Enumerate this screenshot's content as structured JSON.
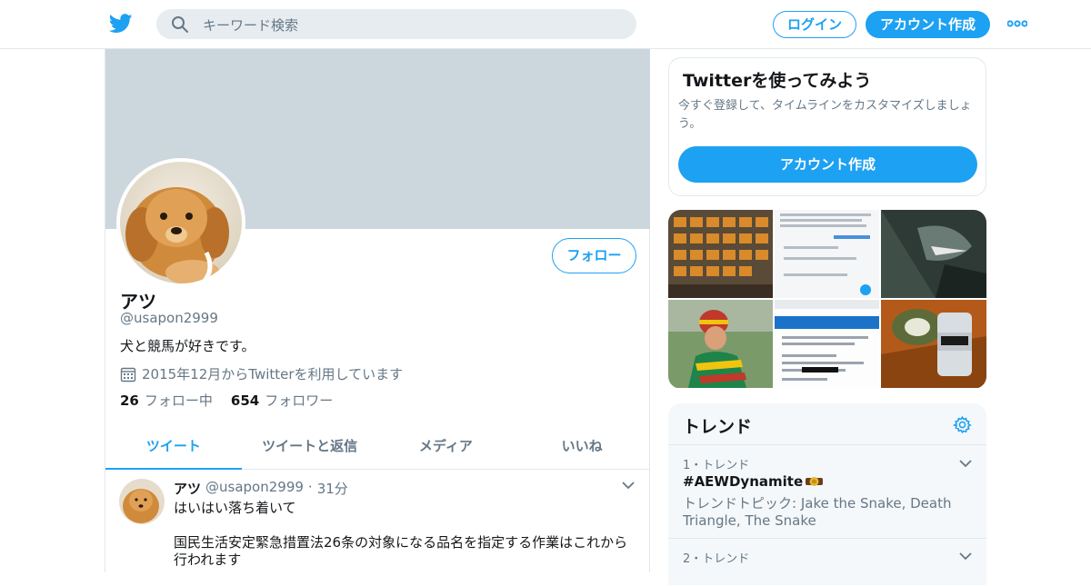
{
  "header": {
    "search_placeholder": "キーワード検索",
    "login_label": "ログイン",
    "signup_label": "アカウント作成"
  },
  "profile": {
    "name": "アツ",
    "handle": "@usapon2999",
    "bio": "犬と競馬が好きです。",
    "joined": "2015年12月からTwitterを利用しています",
    "following_count": "26",
    "following_label": "フォロー中",
    "followers_count": "654",
    "followers_label": "フォロワー",
    "follow_button": "フォロー"
  },
  "tabs": [
    {
      "label": "ツイート",
      "active": true
    },
    {
      "label": "ツイートと返信",
      "active": false
    },
    {
      "label": "メディア",
      "active": false
    },
    {
      "label": "いいね",
      "active": false
    }
  ],
  "tweet": {
    "name": "アツ",
    "handle": "@usapon2999",
    "dot": "·",
    "time": "31分",
    "line1": "はいはい落ち着いて",
    "line2": "国民生活安定緊急措置法26条の対象になる品名を指定する作業はこれから行われます"
  },
  "signup_card": {
    "title": "Twitterを使ってみよう",
    "description": "今すぐ登録して、タイムラインをカスタマイズしましょう。",
    "button": "アカウント作成"
  },
  "trends": {
    "heading": "トレンド",
    "items": [
      {
        "meta": "1・トレンド",
        "name": "#AEWDynamite",
        "desc": "トレンドトピック: Jake the Snake, Death Triangle, The Snake"
      },
      {
        "meta": "2・トレンド"
      }
    ]
  },
  "colors": {
    "accent": "#1da1f2",
    "banner": "#ccd6dd",
    "muted_text": "#657786",
    "border": "#e1e8ed"
  }
}
